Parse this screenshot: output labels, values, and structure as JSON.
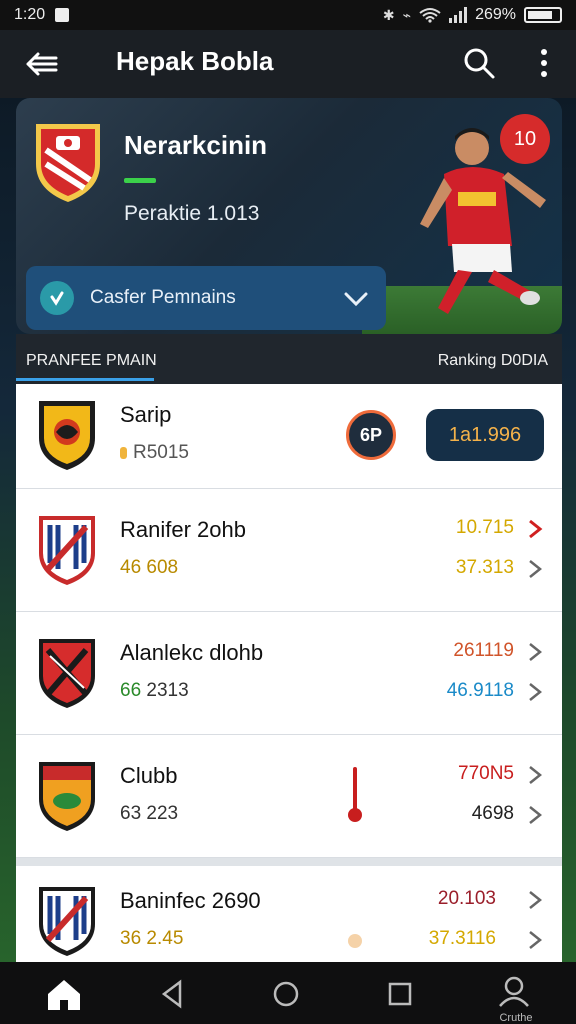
{
  "status_bar": {
    "time": "1:20",
    "battery": "269%"
  },
  "app_bar": {
    "title": "Hepak Bobla"
  },
  "hero": {
    "title": "Nerarkcinin",
    "subtitle": "Peraktie 1.013",
    "rank_badge": "10",
    "dropdown_label": "Casfer Pemnains"
  },
  "tabs": {
    "left": "PRANFEE PMAIN",
    "right": "Ranking D0DIA"
  },
  "rows": [
    {
      "name": "Sarip",
      "meta": "R5015",
      "pill": "1a1.996",
      "badge": "6P"
    },
    {
      "name": "Ranifer 2ohb",
      "meta": "46 608",
      "v1": "10.715",
      "v2": "37.313"
    },
    {
      "name": "Alanlekc dlohb",
      "meta_a": "66",
      "meta_b": "2313",
      "v1": "261119",
      "v2": "46.9118"
    },
    {
      "name": "Clubb",
      "meta": "63 223",
      "v1": "770N5",
      "v2": "4698"
    },
    {
      "name": "Baninfec 2690",
      "meta": "36 2.45",
      "v1": "20.103",
      "v2": "37.3116"
    }
  ],
  "colors": {
    "accent_green": "#3bd14a",
    "badge_red": "#d62b2b",
    "dropdown_blue": "#1f4f7a",
    "tab_underline": "#3aa0e8",
    "pill_bg": "#152f47",
    "pill_text": "#f4b24a"
  },
  "icons": [
    "back-icon",
    "search-icon",
    "more-icon",
    "chevron-down-icon",
    "home-icon",
    "back-nav-icon",
    "home-nav-circle-icon",
    "recents-icon",
    "profile-icon"
  ],
  "bottom_nav": {
    "profile_label": "Cruthe"
  }
}
